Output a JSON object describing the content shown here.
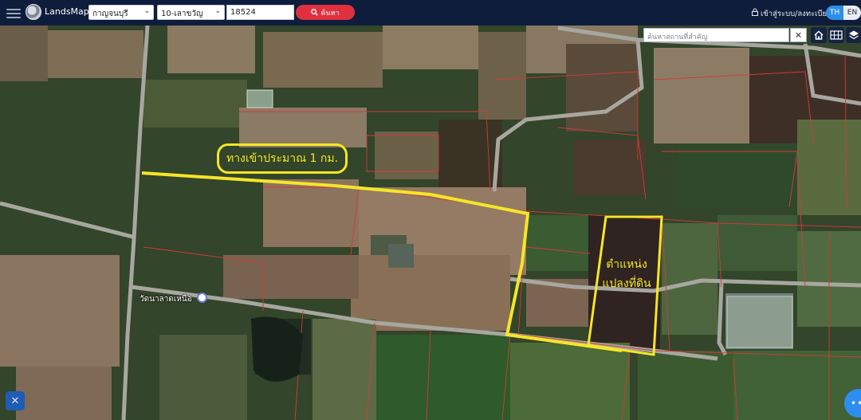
{
  "header": {
    "brand": "LandsMaps",
    "province_select": "กาญจนบุรี",
    "district_select": "10-เลาขวัญ",
    "parcel_number": "18524",
    "search_button": "ค้นหา",
    "login_link": "เข้าสู่ระบบ/ลงทะเบียน",
    "lang_th": "TH",
    "lang_en": "EN"
  },
  "map_tools": {
    "place_search_placeholder": "ค้นหาสถานที่สำคัญ",
    "clear_symbol": "✕",
    "icons": [
      "home-icon",
      "grid-icon",
      "layers-icon",
      "tools-icon",
      "chat-icon"
    ]
  },
  "annotations": {
    "access_road": "ทางเข้าประมาณ 1 กม.",
    "plot_line1": "ตำแหน่ง",
    "plot_line2": "แปลงที่ดิน"
  },
  "map_labels": {
    "temple": "วัดนาลาดเหนือ"
  },
  "colors": {
    "header_bg": "#0f1d3c",
    "search_red": "#e0303e",
    "lang_active": "#2f8ee8",
    "highlight_yellow": "#f5e628",
    "parcel_lines": "#d23a3a"
  }
}
